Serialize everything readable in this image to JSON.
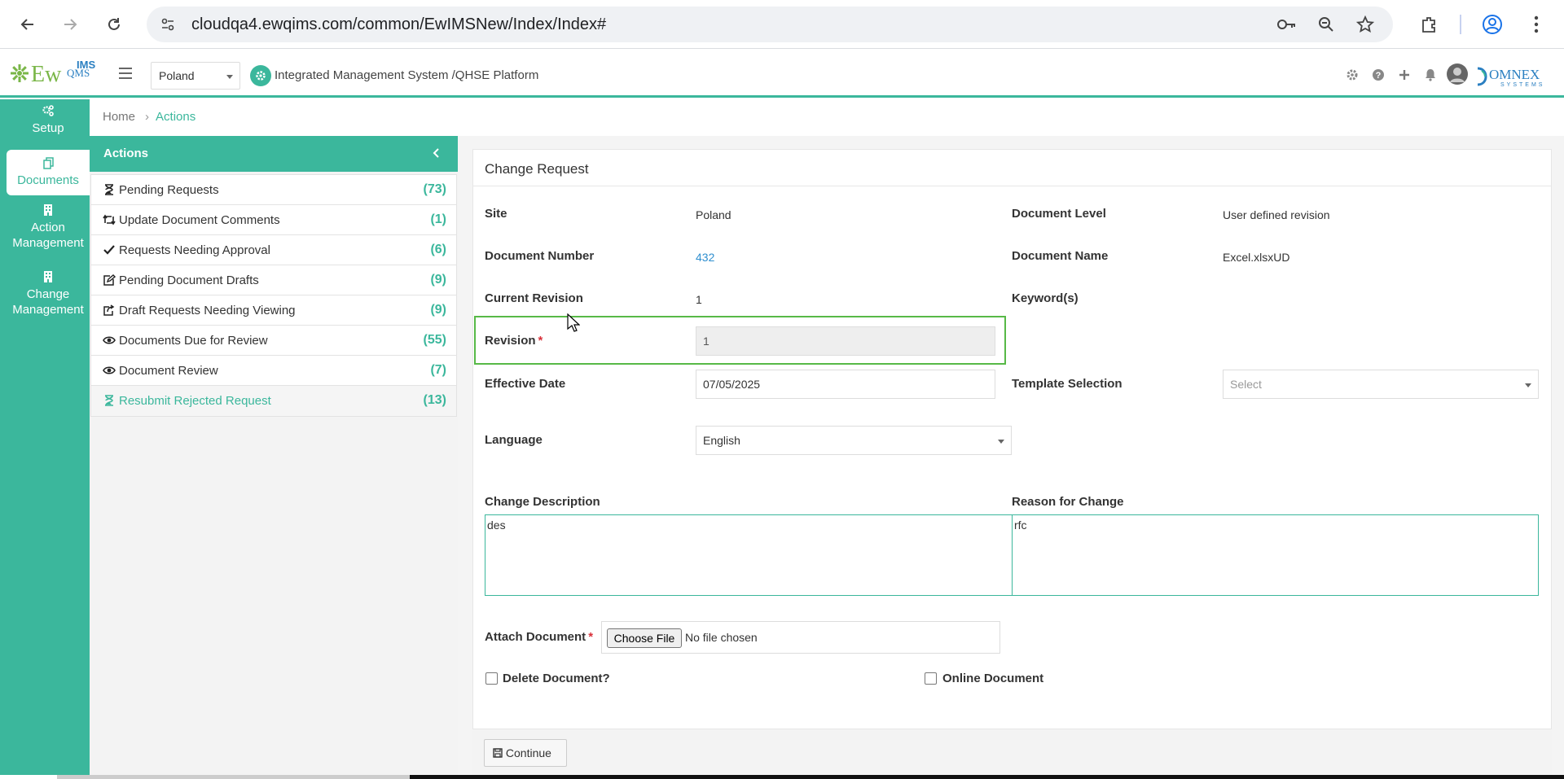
{
  "browser": {
    "url": "cloudqa4.ewqims.com/common/EwIMSNew/Index/Index#"
  },
  "header": {
    "logo_text": "EwQIMS",
    "site_selected": "Poland",
    "platform_title": "Integrated Management System /QHSE Platform",
    "vendor_logo_text": "OMNEX SYSTEMS"
  },
  "rail": {
    "items": [
      {
        "label": "Setup",
        "icon": "gears-icon"
      },
      {
        "label": "Documents",
        "icon": "documents-icon"
      },
      {
        "label": "Action Management",
        "icon": "building-icon"
      },
      {
        "label": "Change Management",
        "icon": "building-icon"
      }
    ]
  },
  "breadcrumb": {
    "home": "Home",
    "current": "Actions"
  },
  "actions": {
    "title": "Actions",
    "items": [
      {
        "label": "Pending Requests",
        "count": "(73)",
        "icon": "hourglass-icon"
      },
      {
        "label": "Update Document Comments",
        "count": "(1)",
        "icon": "retweet-icon"
      },
      {
        "label": "Requests Needing Approval",
        "count": "(6)",
        "icon": "check-icon"
      },
      {
        "label": "Pending Document Drafts",
        "count": "(9)",
        "icon": "edit-icon"
      },
      {
        "label": "Draft Requests Needing Viewing",
        "count": "(9)",
        "icon": "share-icon"
      },
      {
        "label": "Documents Due for Review",
        "count": "(55)",
        "icon": "eye-icon"
      },
      {
        "label": "Document Review",
        "count": "(7)",
        "icon": "eye-icon"
      },
      {
        "label": "Resubmit Rejected Request",
        "count": "(13)",
        "icon": "hourglass-icon"
      }
    ]
  },
  "form": {
    "title": "Change Request",
    "site_label": "Site",
    "site_value": "Poland",
    "doc_level_label": "Document Level",
    "doc_level_value": "User defined revision",
    "doc_number_label": "Document Number",
    "doc_number_value": "432",
    "doc_name_label": "Document Name",
    "doc_name_value": "Excel.xlsxUD",
    "current_revision_label": "Current Revision",
    "current_revision_value": "1",
    "keywords_label": "Keyword(s)",
    "revision_label": "Revision",
    "revision_required": "*",
    "revision_value": "1",
    "effective_date_label": "Effective Date",
    "effective_date_value": "07/05/2025",
    "template_label": "Template Selection",
    "template_placeholder": "Select",
    "language_label": "Language",
    "language_value": "English",
    "change_desc_label": "Change Description",
    "change_desc_value": "des",
    "reason_label": "Reason for Change",
    "reason_value": "rfc",
    "attach_label": "Attach Document",
    "attach_required": "*",
    "choose_file_label": "Choose File",
    "no_file_text": "No file chosen",
    "delete_doc_label": "Delete Document?",
    "online_doc_label": "Online Document",
    "continue_label": "Continue"
  },
  "colors": {
    "accent": "#3bb79c",
    "link": "#2f8fcf",
    "required": "#d9303a",
    "highlight": "#57b947"
  }
}
